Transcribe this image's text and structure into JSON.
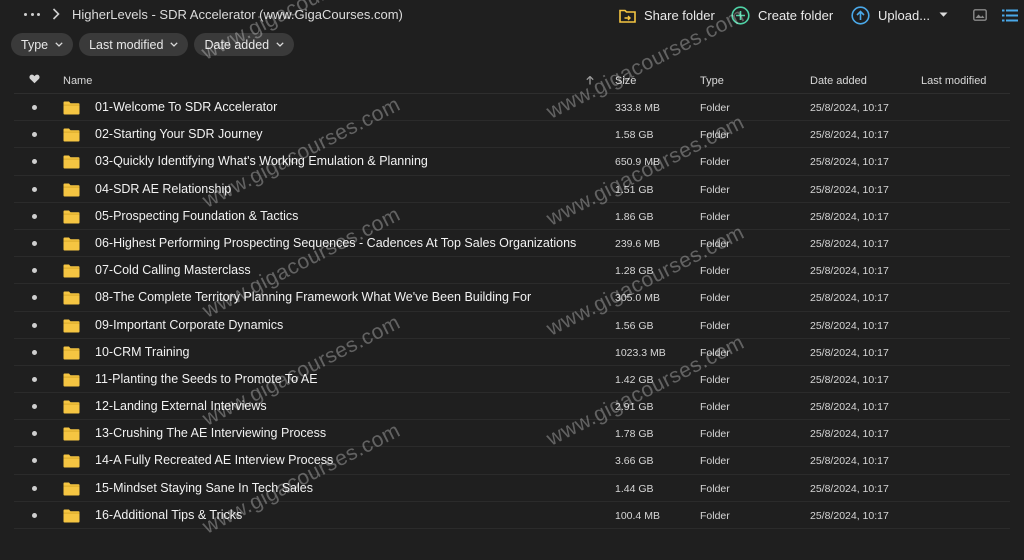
{
  "breadcrumb": {
    "title": "HigherLevels - SDR Accelerator (www.GigaCourses.com)"
  },
  "actions": {
    "share_label": "Share folder",
    "create_label": "Create folder",
    "upload_label": "Upload..."
  },
  "filters": {
    "type": "Type",
    "modified": "Last modified",
    "added": "Date added"
  },
  "columns": {
    "name": "Name",
    "size": "Size",
    "type": "Type",
    "added": "Date added",
    "modified": "Last modified"
  },
  "rows": [
    {
      "name": "01-Welcome To SDR Accelerator",
      "size": "333.8 MB",
      "type": "Folder",
      "added": "25/8/2024, 10:17",
      "modified": ""
    },
    {
      "name": "02-Starting Your SDR Journey",
      "size": "1.58 GB",
      "type": "Folder",
      "added": "25/8/2024, 10:17",
      "modified": ""
    },
    {
      "name": "03-Quickly Identifying What's Working Emulation & Planning",
      "size": "650.9 MB",
      "type": "Folder",
      "added": "25/8/2024, 10:17",
      "modified": ""
    },
    {
      "name": "04-SDR AE Relationship",
      "size": "1.51 GB",
      "type": "Folder",
      "added": "25/8/2024, 10:17",
      "modified": ""
    },
    {
      "name": "05-Prospecting Foundation & Tactics",
      "size": "1.86 GB",
      "type": "Folder",
      "added": "25/8/2024, 10:17",
      "modified": ""
    },
    {
      "name": "06-Highest Performing Prospecting Sequences - Cadences At Top Sales Organizations",
      "size": "239.6 MB",
      "type": "Folder",
      "added": "25/8/2024, 10:17",
      "modified": ""
    },
    {
      "name": "07-Cold Calling Masterclass",
      "size": "1.28 GB",
      "type": "Folder",
      "added": "25/8/2024, 10:17",
      "modified": ""
    },
    {
      "name": "08-The Complete Territory Planning Framework What We've Been Building For",
      "size": "305.0 MB",
      "type": "Folder",
      "added": "25/8/2024, 10:17",
      "modified": ""
    },
    {
      "name": "09-Important Corporate Dynamics",
      "size": "1.56 GB",
      "type": "Folder",
      "added": "25/8/2024, 10:17",
      "modified": ""
    },
    {
      "name": "10-CRM Training",
      "size": "1023.3 MB",
      "type": "Folder",
      "added": "25/8/2024, 10:17",
      "modified": ""
    },
    {
      "name": "11-Planting the Seeds to Promote To AE",
      "size": "1.42 GB",
      "type": "Folder",
      "added": "25/8/2024, 10:17",
      "modified": ""
    },
    {
      "name": "12-Landing External Interviews",
      "size": "2.91 GB",
      "type": "Folder",
      "added": "25/8/2024, 10:17",
      "modified": ""
    },
    {
      "name": "13-Crushing The AE Interviewing Process",
      "size": "1.78 GB",
      "type": "Folder",
      "added": "25/8/2024, 10:17",
      "modified": ""
    },
    {
      "name": "14-A Fully Recreated AE Interview Process",
      "size": "3.66 GB",
      "type": "Folder",
      "added": "25/8/2024, 10:17",
      "modified": ""
    },
    {
      "name": "15-Mindset Staying Sane In Tech Sales",
      "size": "1.44 GB",
      "type": "Folder",
      "added": "25/8/2024, 10:17",
      "modified": ""
    },
    {
      "name": "16-Additional Tips & Tricks",
      "size": "100.4 MB",
      "type": "Folder",
      "added": "25/8/2024, 10:17",
      "modified": ""
    }
  ],
  "watermark": {
    "text": "www.gigacourses.com"
  },
  "colors": {
    "background": "#1f1f1f",
    "folder": "#f5c542",
    "accent_create": "#4fd1a5",
    "accent_upload": "#4aa8e8",
    "chip": "#3a3a3a"
  }
}
